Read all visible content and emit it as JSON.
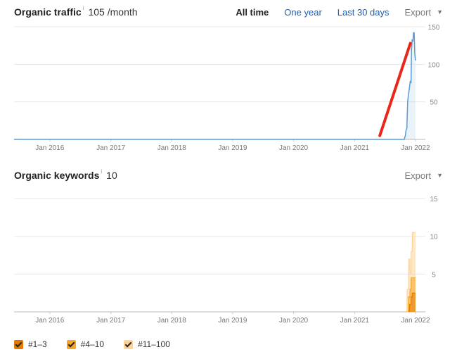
{
  "traffic": {
    "title": "Organic traffic",
    "info": "i",
    "value": "105 /month",
    "ranges": [
      "All time",
      "One year",
      "Last 30 days"
    ],
    "export_label": "Export",
    "export_caret": "▼"
  },
  "keywords": {
    "title": "Organic keywords",
    "info": "i",
    "value": "10",
    "export_label": "Export",
    "export_caret": "▼"
  },
  "legend": {
    "items": [
      {
        "label": "#1–3",
        "color": "#e07b00"
      },
      {
        "label": "#4–10",
        "color": "#f5a623"
      },
      {
        "label": "#11–100",
        "color": "#fbd49c"
      }
    ]
  },
  "chart_data": [
    {
      "type": "area",
      "title": "Organic traffic",
      "x_tick_labels": [
        "Jan 2016",
        "Jan 2017",
        "Jan 2018",
        "Jan 2019",
        "Jan 2020",
        "Jan 2021",
        "Jan 2022"
      ],
      "y_ticks": [
        50,
        100,
        150
      ],
      "ylim": [
        0,
        150
      ],
      "xlim": [
        "2015-06-01",
        "2022-03-01"
      ],
      "grid": true,
      "series": [
        {
          "color": "#5b9bd5",
          "points": [
            [
              "2015-06-01",
              0
            ],
            [
              "2021-10-25",
              0
            ],
            [
              "2021-11-01",
              5
            ],
            [
              "2021-11-05",
              12
            ],
            [
              "2021-11-10",
              15
            ],
            [
              "2021-11-15",
              50
            ],
            [
              "2021-11-20",
              60
            ],
            [
              "2021-11-25",
              68
            ],
            [
              "2021-12-01",
              78
            ],
            [
              "2021-12-05",
              75
            ],
            [
              "2021-12-08",
              120
            ],
            [
              "2021-12-12",
              133
            ],
            [
              "2021-12-16",
              130
            ],
            [
              "2021-12-20",
              142
            ],
            [
              "2021-12-24",
              142
            ],
            [
              "2021-12-28",
              113
            ],
            [
              "2022-01-01",
              105
            ]
          ]
        }
      ],
      "annotations": [
        {
          "type": "arrow-line",
          "color": "#e8261a",
          "from": [
            "2021-06-01",
            5
          ],
          "to": [
            "2021-12-01",
            128
          ]
        }
      ]
    },
    {
      "type": "area",
      "title": "Organic keywords",
      "x_tick_labels": [
        "Jan 2016",
        "Jan 2017",
        "Jan 2018",
        "Jan 2019",
        "Jan 2020",
        "Jan 2021",
        "Jan 2022"
      ],
      "y_ticks": [
        5,
        10,
        15
      ],
      "ylim": [
        0,
        15
      ],
      "xlim": [
        "2015-06-01",
        "2022-03-01"
      ],
      "grid": true,
      "stacked": true,
      "series": [
        {
          "name": "#11–100",
          "color": "#fbd49c",
          "points": [
            [
              "2021-11-10",
              0
            ],
            [
              "2021-11-12",
              3
            ],
            [
              "2021-11-20",
              3
            ],
            [
              "2021-11-21",
              7
            ],
            [
              "2021-11-28",
              7
            ],
            [
              "2021-11-29",
              5
            ],
            [
              "2021-12-05",
              5
            ],
            [
              "2021-12-06",
              8
            ],
            [
              "2021-12-12",
              8
            ],
            [
              "2021-12-13",
              10.5
            ],
            [
              "2022-01-01",
              10.5
            ]
          ]
        },
        {
          "name": "#4–10",
          "color": "#f5a623",
          "points": [
            [
              "2021-11-18",
              0
            ],
            [
              "2021-11-20",
              2
            ],
            [
              "2021-11-28",
              2
            ],
            [
              "2021-11-29",
              3
            ],
            [
              "2021-12-05",
              3
            ],
            [
              "2021-12-06",
              4.5
            ],
            [
              "2022-01-01",
              4.5
            ]
          ]
        },
        {
          "name": "#1–3",
          "color": "#e07b00",
          "points": [
            [
              "2021-11-25",
              0
            ],
            [
              "2021-11-27",
              1
            ],
            [
              "2021-12-05",
              1
            ],
            [
              "2021-12-06",
              2
            ],
            [
              "2021-12-12",
              2
            ],
            [
              "2021-12-13",
              2.5
            ],
            [
              "2022-01-01",
              2.5
            ]
          ]
        }
      ]
    }
  ]
}
